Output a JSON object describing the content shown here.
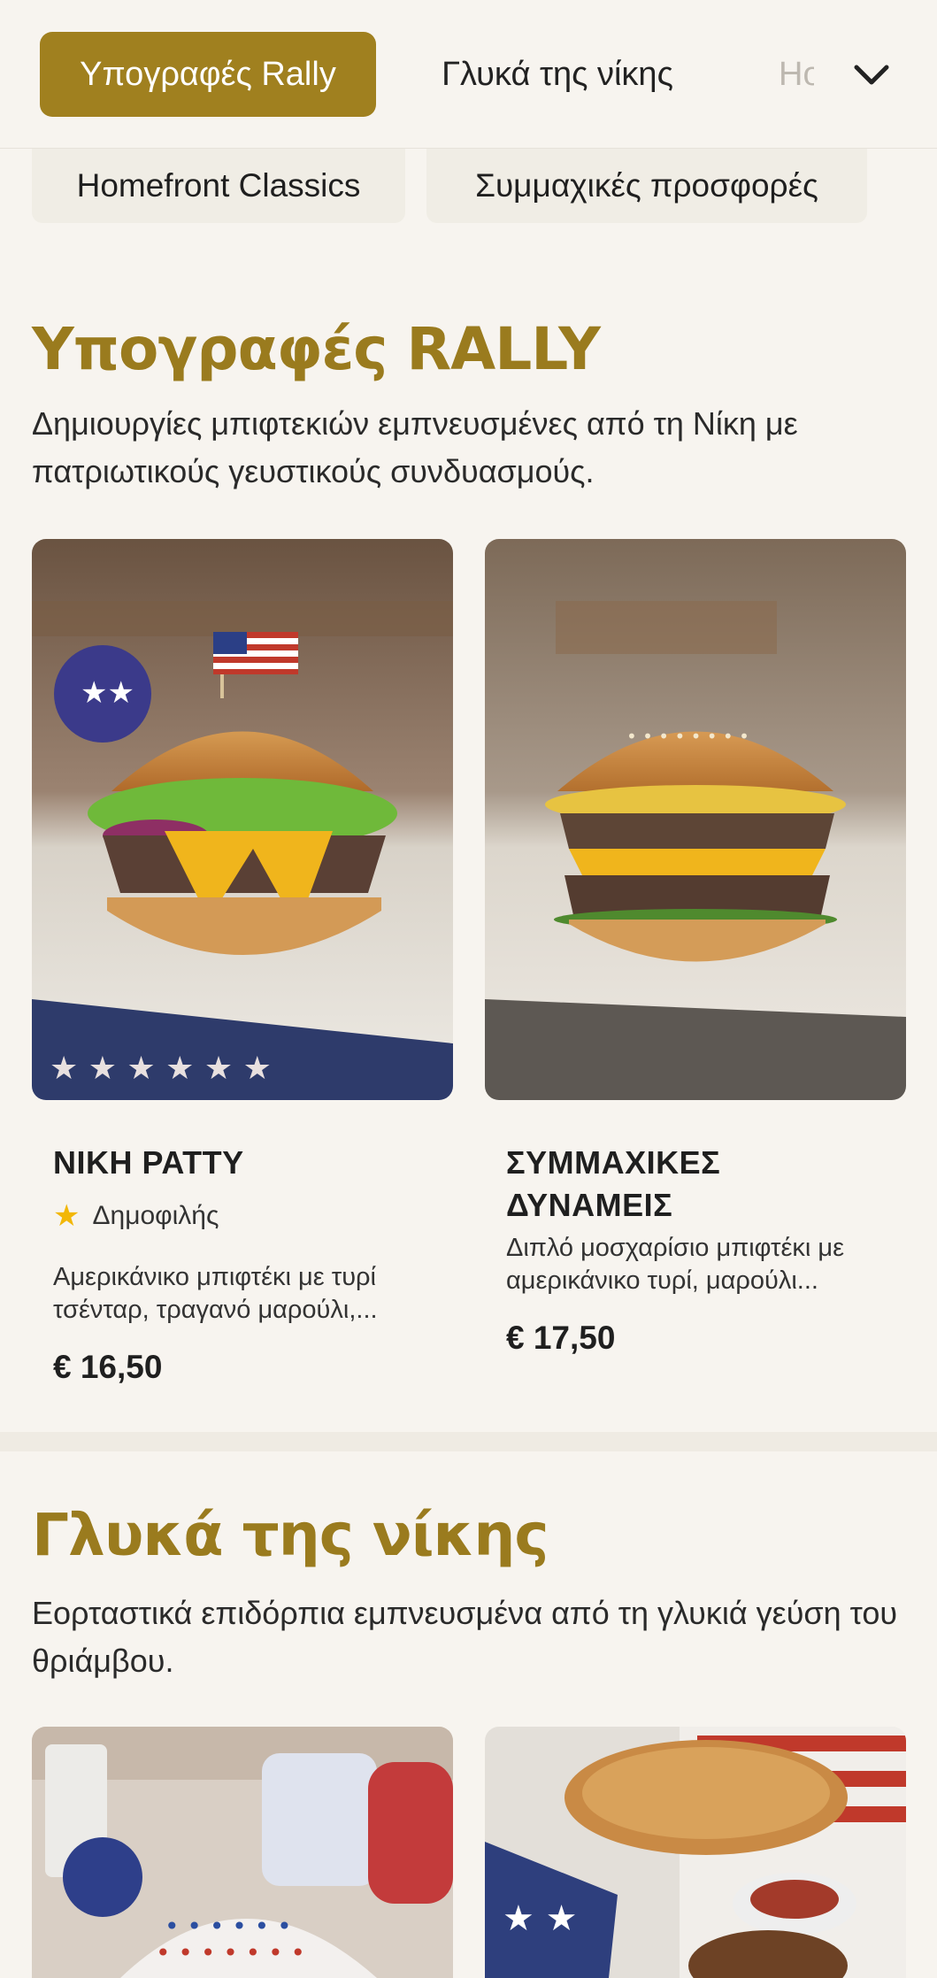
{
  "nav": {
    "tabs": [
      {
        "label": "Υπογραφές Rally",
        "active": true
      },
      {
        "label": "Γλυκά της νίκης"
      },
      {
        "label": "Hor"
      }
    ],
    "more_icon": "chevron-down-icon"
  },
  "subnav": [
    "Homefront Classics",
    "Συμμαχικές προσφορές"
  ],
  "sections": [
    {
      "title": "Υπογραφές RALLY",
      "description": "Δημιουργίες μπιφτεκιών εμπνευσμένες από τη Νίκη με πατριωτικούς γευστικούς συνδυασμούς.",
      "items": [
        {
          "name": "ΝΙΚΗ PATTY",
          "badge": "Δημοφιλής",
          "description": "Αμερικάνικο μπιφτέκι με τυρί τσένταρ, τραγανό μαρούλι,...",
          "price": "€ 16,50"
        },
        {
          "name": "ΣΥΜΜΑΧΙΚΕΣ ΔΥΝΑΜΕΙΣ",
          "description": "Διπλό μοσχαρίσιο μπιφτέκι με αμερικάνικο τυρί, μαρούλι...",
          "price": "€ 17,50"
        }
      ]
    },
    {
      "title": "Γλυκά της νίκης",
      "description": "Εορταστικά επιδόρπια εμπνευσμένα από τη γλυκιά γεύση του θριάμβου."
    }
  ],
  "colors": {
    "accent": "#a0801f",
    "background": "#f7f4ef",
    "star": "#f2b707"
  }
}
